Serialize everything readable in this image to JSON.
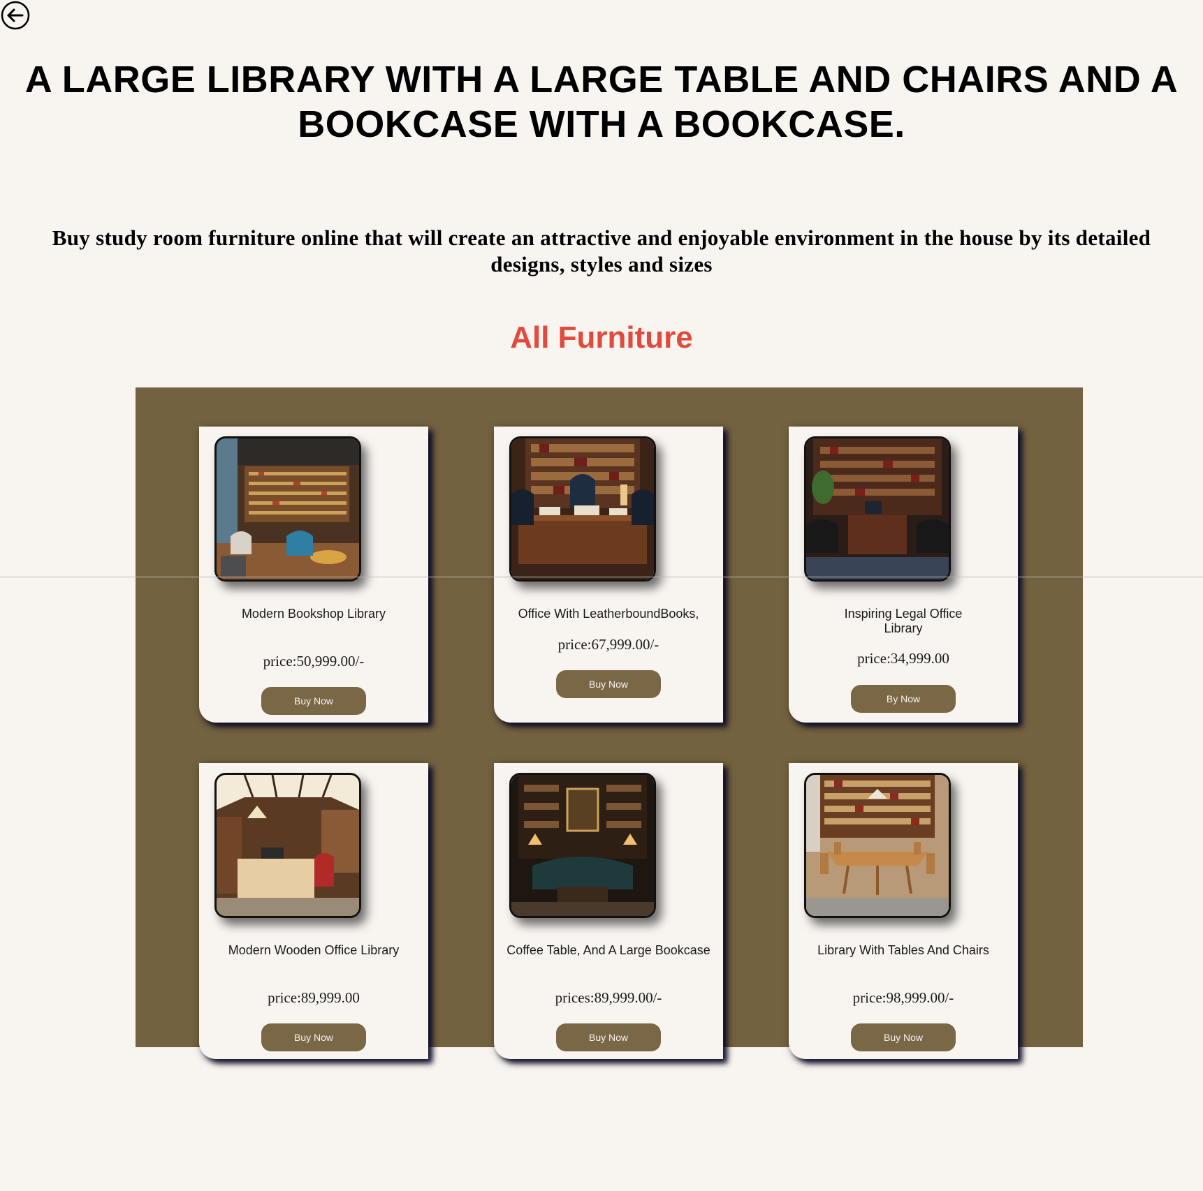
{
  "nav": {
    "back_icon": "back-arrow-icon"
  },
  "page": {
    "title": "A LARGE LIBRARY WITH A LARGE TABLE AND CHAIRS AND A BOOKCASE WITH A BOOKCASE.",
    "subtitle": "Buy study room furniture online that will create an attractive and enjoyable environment in the house by its detailed designs, styles and sizes",
    "section_title": "All Furniture"
  },
  "colors": {
    "background": "#f8f4f0",
    "panel": "#736240",
    "accent_red": "#e14a3c",
    "button": "#7a6745",
    "text": "#000000"
  },
  "products": [
    {
      "name": "Modern Bookshop Library",
      "price": "price:50,999.00/-",
      "button_label": "Buy Now",
      "image": "modern-bookshop-library-photo"
    },
    {
      "name": "Office With LeatherboundBooks,",
      "price": "price:67,999.00/-",
      "button_label": "Buy Now",
      "image": "leatherbound-office-photo"
    },
    {
      "name": "Inspiring Legal Office Library",
      "price": "price:34,999.00",
      "button_label": "By Now",
      "image": "legal-office-library-photo"
    },
    {
      "name": "Modern Wooden Office Library",
      "price": "price:89,999.00",
      "button_label": "Buy Now",
      "image": "wooden-office-library-photo"
    },
    {
      "name": "Coffee Table, And A Large Bookcase",
      "price": "prices:89,999.00/-",
      "button_label": "Buy Now",
      "image": "coffee-table-bookcase-photo"
    },
    {
      "name": "Library With Tables And Chairs",
      "price": "price:98,999.00/-",
      "button_label": "Buy Now",
      "image": "library-tables-chairs-photo"
    }
  ]
}
